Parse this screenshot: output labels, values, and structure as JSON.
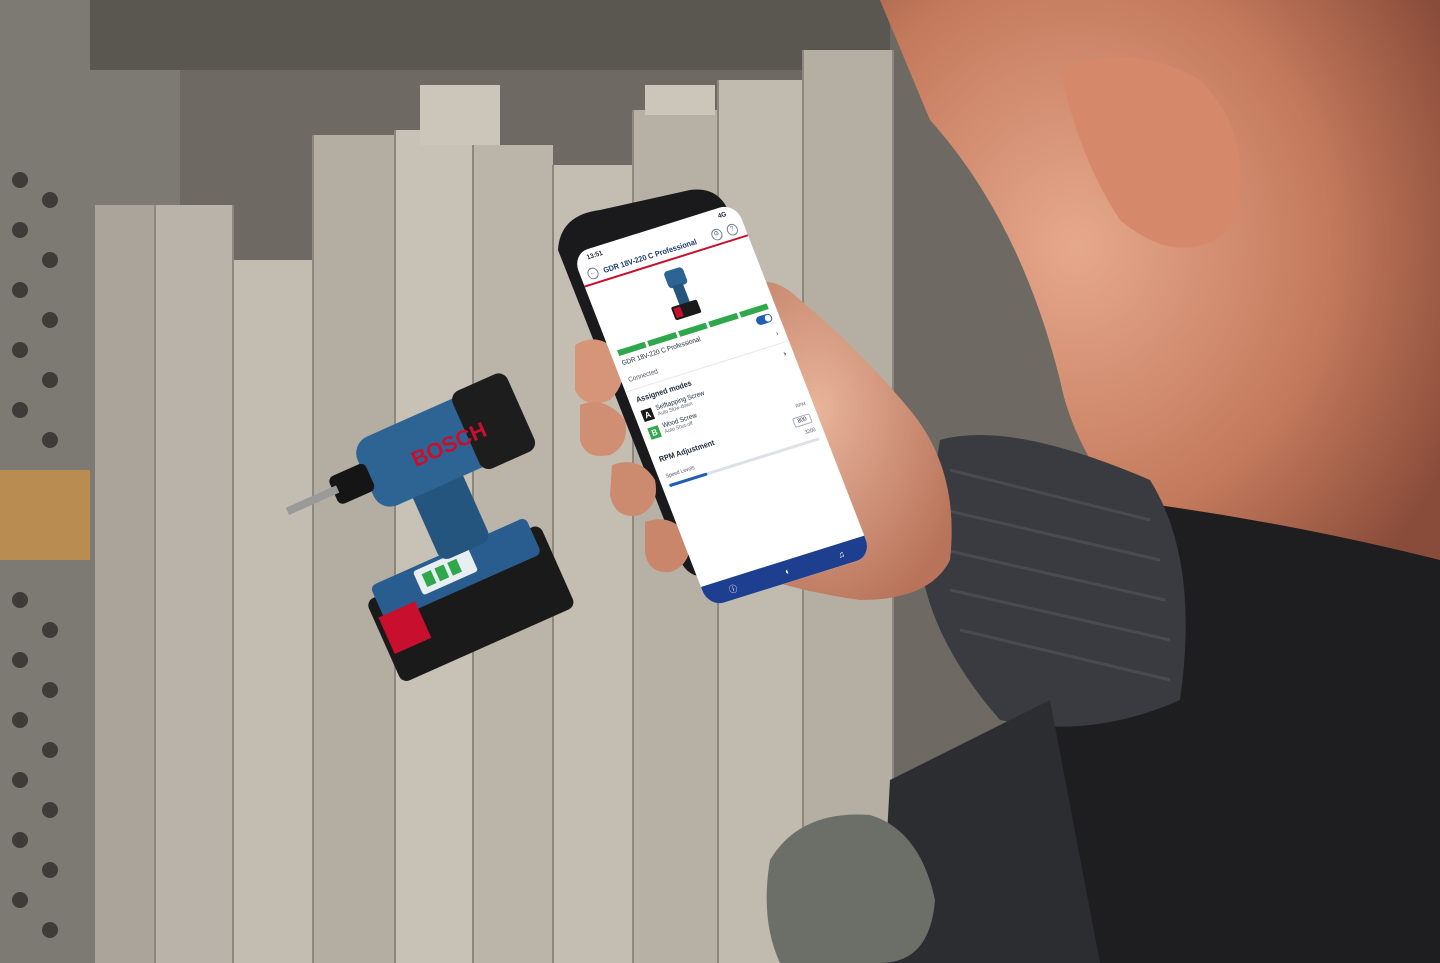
{
  "phone": {
    "status_time": "13:51",
    "network": "4G",
    "header_title": "GDR 18V-220 C Professional",
    "device_name": "GDR 18V-220 C Professional",
    "connection_status": "Connected",
    "battery_segments": 5,
    "assigned_modes_title": "Assigned modes",
    "modes": [
      {
        "letter": "A",
        "name": "Selftapping Screw",
        "sub": "Auto Slow-down"
      },
      {
        "letter": "B",
        "name": "Wood Screw",
        "sub": "Auto Shut-off"
      }
    ],
    "rpm_title": "RPM Adjustment",
    "rpm_unit": "RPM",
    "rpm_value": "800",
    "speed_levels_label": "Speed Levels",
    "speed_max": "3200",
    "slider_fraction": 0.25
  },
  "tool": {
    "brand_text": "BOSCH"
  },
  "colors": {
    "bosch_blue": "#1e5fb4",
    "bosch_red": "#c8102e",
    "battery_green": "#2ea84a",
    "wood": "#b8b2a8"
  }
}
